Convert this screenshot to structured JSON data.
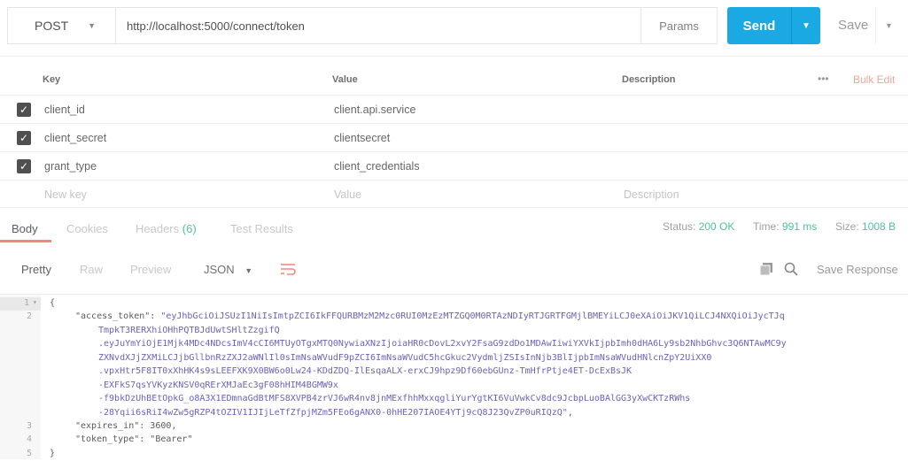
{
  "request": {
    "method": "POST",
    "url": "http://localhost:5000/connect/token",
    "params_label": "Params",
    "send_label": "Send",
    "save_label": "Save"
  },
  "params_table": {
    "headers": [
      "Key",
      "Value",
      "Description"
    ],
    "more": "•••",
    "bulk_edit": "Bulk Edit",
    "rows": [
      {
        "key": "client_id",
        "value": "client.api.service",
        "checked": true
      },
      {
        "key": "client_secret",
        "value": "clientsecret",
        "checked": true
      },
      {
        "key": "grant_type",
        "value": "client_credentials",
        "checked": true
      }
    ],
    "new_row": {
      "key": "New key",
      "value": "Value",
      "description": "Description"
    }
  },
  "response": {
    "tabs": [
      "Body",
      "Cookies",
      "Headers",
      "Test Results"
    ],
    "headers_count": "(6)",
    "status_label": "Status:",
    "status": "200 OK",
    "time_label": "Time:",
    "time": "991 ms",
    "size_label": "Size:",
    "size": "1008 B",
    "views": [
      "Pretty",
      "Raw",
      "Preview"
    ],
    "format": "JSON",
    "save_response": "Save Response",
    "lines": {
      "l1": "{",
      "key_token": "\"access_token\": ",
      "t1": "\"eyJhbGciOiJSUzI1NiIsImtpZCI6IkFFQURBMzM2Mzc0RUI0MzEzMTZGQ0M0RTAzNDIyRTJGRTFGMjlBMEYiLCJ0eXAiOiJKV1QiLCJ4NXQiOiJycTJq",
      "t2": "TmpkT3RERXhiOHhPQTBJdUwtSHltZzgifQ",
      "t3": ".eyJuYmYiOjE1Mjk4MDc4NDcsImV4cCI6MTUyOTgxMTQ0NywiaXNzIjoiaHR0cDovL2xvY2FsaG9zdDo1MDAwIiwiYXVkIjpbImh0dHA6Ly9sb2NhbGhvc3Q6NTAwMC9y",
      "t4": "ZXNvdXJjZXMiLCJjbGllbnRzZXJ2aWNlIl0sImNsaWVudF9pZCI6ImNsaWVudC5hcGkuc2VydmljZSIsInNjb3BlIjpbImNsaWVudHNlcnZpY2UiXX0",
      "t5": ".vpxHtr5F8IT0xXhHK4s9sLEEFXK9X0BW6o0Lw24-KDdZDQ-IlEsqaALX-erxCJ9hpz9Df60ebGUnz-TmHfrPtje4ET-DcExBsJK",
      "t6": "-EXFkS7qsYVKyzKNSV0qRErXMJaEc3gF08hHIM4BGMW9x",
      "t7": "-f9bkDzUhBEtOpkG_o8A3X1EDmnaGdBtMFS8XVPB4zrVJ6wR4nv8jnMExfhhMxxqgliYurYgtKI6VuVwkCv8dc9JcbpLuoBAlGG3yXwCKTzRWhs",
      "t8": "-28Yqii6sRiI4wZw5gRZP4tOZIV1IJIjLeTfZfpjMZm5FEo6gANX0-0hHE207IAOE4YTj9cQ8J23QvZP0uRIQzQ\"",
      "comma": ",",
      "l3key": "\"expires_in\": ",
      "l3val": "3600,",
      "l4key": "\"token_type\": ",
      "l4val": "\"Bearer\"",
      "l5": "}"
    },
    "line_numbers": [
      "1",
      "2",
      "3",
      "4",
      "5"
    ]
  },
  "colors": {
    "accent": "#1aa9e2",
    "status_ok": "#4fc39a",
    "tab_underline": "#f08a7e"
  }
}
